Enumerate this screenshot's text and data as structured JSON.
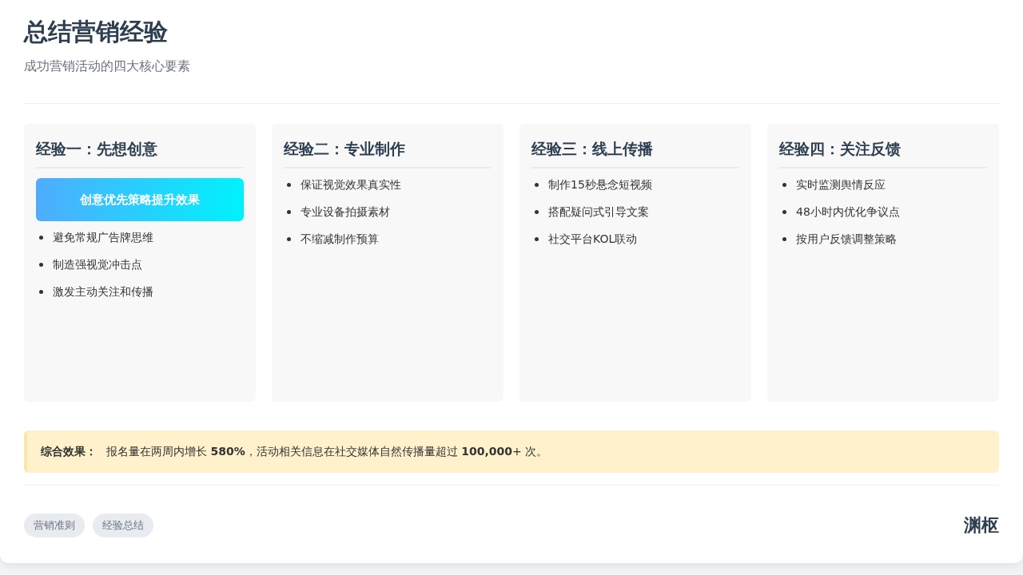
{
  "header": {
    "title": "总结营销经验",
    "subtitle": "成功营销活动的四大核心要素"
  },
  "cards": [
    {
      "title": "经验一：先想创意",
      "highlight": "创意优先策略提升效果",
      "points": [
        "避免常规广告牌思维",
        "制造强视觉冲击点",
        "激发主动关注和传播"
      ]
    },
    {
      "title": "经验二：专业制作",
      "points": [
        "保证视觉效果真实性",
        "专业设备拍摄素材",
        "不缩减制作预算"
      ]
    },
    {
      "title": "经验三：线上传播",
      "points": [
        "制作15秒悬念短视频",
        "搭配疑问式引导文案",
        "社交平台KOL联动"
      ]
    },
    {
      "title": "经验四：关注反馈",
      "points": [
        "实时监测舆情反应",
        "48小时内优化争议点",
        "按用户反馈调整策略"
      ]
    }
  ],
  "summary": {
    "label": "综合效果：",
    "text": "报名量在两周内增长 **580%**，活动相关信息在社交媒体自然传播量超过 **100,000**+ 次。"
  },
  "footer": {
    "tags": [
      "营销准则",
      "经验总结"
    ],
    "brand": "渊枢"
  }
}
